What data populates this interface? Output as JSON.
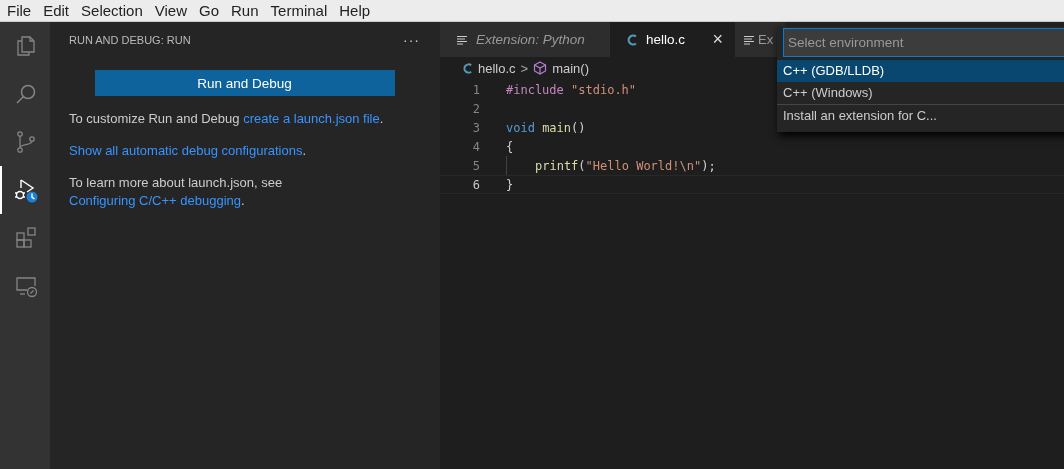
{
  "menu_bar": [
    "File",
    "Edit",
    "Selection",
    "View",
    "Go",
    "Run",
    "Terminal",
    "Help"
  ],
  "activity_bar": [
    {
      "kind": "files",
      "selected": false
    },
    {
      "kind": "search",
      "selected": false
    },
    {
      "kind": "source-control",
      "selected": false
    },
    {
      "kind": "debug",
      "selected": true
    },
    {
      "kind": "extensions",
      "selected": false
    },
    {
      "kind": "remote",
      "selected": false
    }
  ],
  "sidebar": {
    "title": "RUN AND DEBUG: RUN",
    "more": "···",
    "button": "Run and Debug",
    "paragraphs": [
      [
        {
          "kind": "text",
          "text": "To customize Run and Debug "
        },
        {
          "kind": "link",
          "text": "create a launch.json file"
        },
        {
          "kind": "text",
          "text": "."
        }
      ],
      [
        {
          "kind": "link",
          "text": "Show all automatic debug configurations"
        },
        {
          "kind": "text",
          "text": "."
        }
      ],
      [
        {
          "kind": "text",
          "text": "To learn more about launch.json, see "
        },
        {
          "kind": "link",
          "text": "Configuring C/C++ debugging"
        },
        {
          "kind": "text",
          "text": "."
        }
      ]
    ]
  },
  "tabs": [
    {
      "label": "Extension: Python",
      "kind": "preview",
      "selected": false
    },
    {
      "label": "hello.c",
      "kind": "c",
      "selected": true,
      "close": "×"
    },
    {
      "label": "Ex",
      "kind": "text",
      "selected": false
    }
  ],
  "breadcrumb": {
    "file": "hello.c",
    "separator": ">",
    "symbol": "main()"
  },
  "editor": {
    "lines": [
      {
        "number": "1",
        "current": false,
        "indented": false,
        "tokens": [
          {
            "kind": "keyword",
            "text": "#include "
          },
          {
            "kind": "string",
            "text": "\"stdio.h\""
          }
        ]
      },
      {
        "number": "2",
        "current": false,
        "indented": false
      },
      {
        "number": "3",
        "current": false,
        "indented": false,
        "tokens": [
          {
            "kind": "type",
            "text": "void "
          },
          {
            "kind": "function",
            "text": "main"
          },
          {
            "kind": "plain",
            "text": "()"
          }
        ]
      },
      {
        "number": "4",
        "current": false,
        "indented": false,
        "tokens": [
          {
            "kind": "plain",
            "text": "{"
          }
        ]
      },
      {
        "number": "5",
        "current": false,
        "indented": true,
        "tokens": [
          {
            "kind": "function",
            "text": "printf"
          },
          {
            "kind": "plain",
            "text": "("
          },
          {
            "kind": "string",
            "text": "\"Hello World!\\n\""
          },
          {
            "kind": "plain",
            "text": ");"
          }
        ]
      },
      {
        "number": "6",
        "current": true,
        "indented": false,
        "tokens": [
          {
            "kind": "plain",
            "text": "}"
          }
        ]
      }
    ]
  },
  "quick_pick": {
    "placeholder": "Select environment",
    "items": [
      {
        "label": "C++ (GDB/LLDB)",
        "selected": true,
        "separated": false
      },
      {
        "label": "C++ (Windows)",
        "selected": false,
        "separated": false
      },
      {
        "label": "Install an extension for C...",
        "selected": false,
        "separated": true
      }
    ]
  }
}
